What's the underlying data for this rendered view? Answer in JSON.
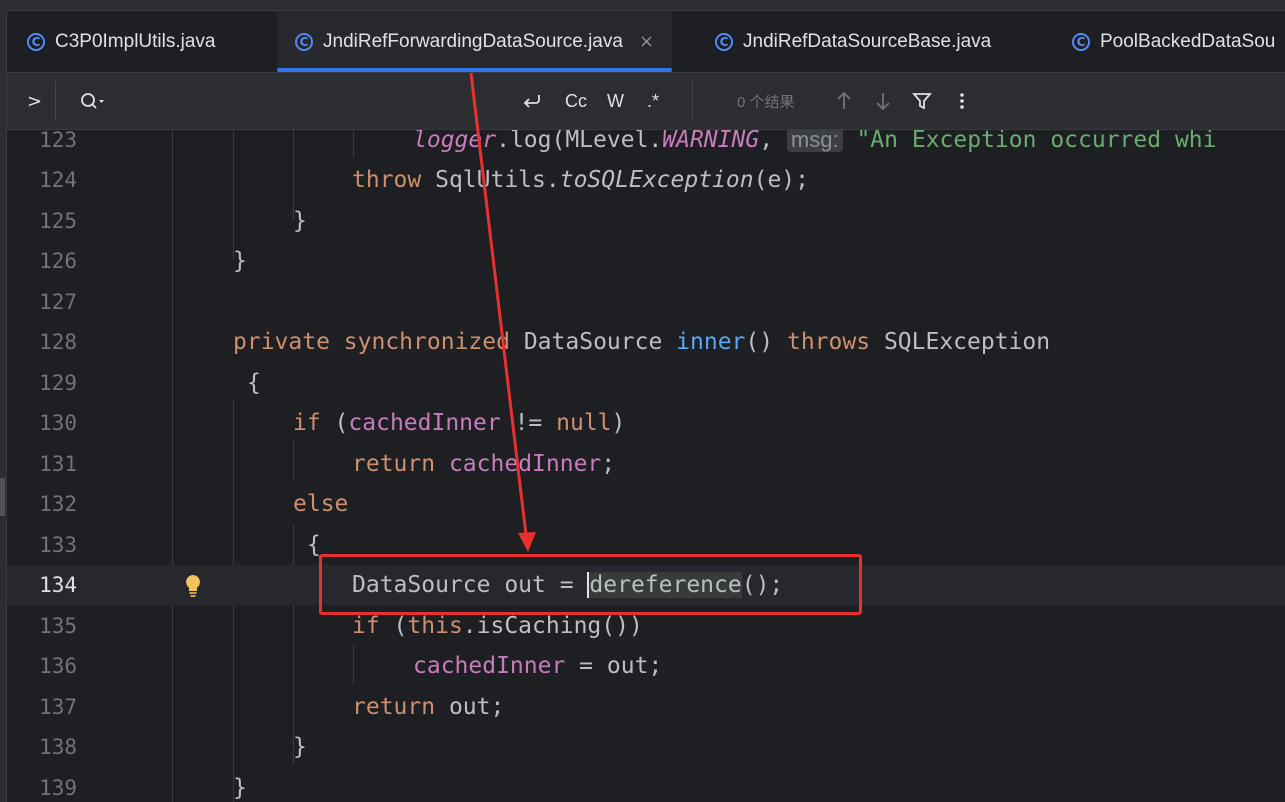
{
  "tabs": [
    {
      "label": "C3P0ImplUtils.java",
      "active": false
    },
    {
      "label": "JndiRefForwardingDataSource.java",
      "active": true
    },
    {
      "label": "JndiRefDataSourceBase.java",
      "active": false
    },
    {
      "label": "PoolBackedDataSou",
      "active": false
    }
  ],
  "tab_close_glyph": "×",
  "tab_icon_letter": "C",
  "search": {
    "expand_glyph": ">",
    "search_glyph": "Q",
    "match_case": "Cc",
    "words": "W",
    "regex": ".*",
    "results": "0 个结果"
  },
  "code_lines": [
    {
      "num": "123"
    },
    {
      "num": "124"
    },
    {
      "num": "125"
    },
    {
      "num": "126"
    },
    {
      "num": "127"
    },
    {
      "num": "128"
    },
    {
      "num": "129"
    },
    {
      "num": "130"
    },
    {
      "num": "131"
    },
    {
      "num": "132"
    },
    {
      "num": "133"
    },
    {
      "num": "134"
    },
    {
      "num": "135"
    },
    {
      "num": "136"
    },
    {
      "num": "137"
    },
    {
      "num": "138"
    },
    {
      "num": "139"
    }
  ],
  "code": {
    "l123": {
      "obj": "logger",
      "call": ".log(MLevel.",
      "const": "WARNING",
      "comma": ", ",
      "hint": "msg:",
      "str": "\"An Exception occurred whi"
    },
    "l124": {
      "kw": "throw",
      "cls": " SqlUtils.",
      "method": "toSQLException",
      "rest": "(e);"
    },
    "l125": {
      "text": "}"
    },
    "l126": {
      "text": "}"
    },
    "l128": {
      "kw1": "private",
      "kw2": "synchronized",
      "type": "DataSource",
      "method": "inner",
      "paren": "()",
      "kw3": "throws",
      "exc": "SQLException"
    },
    "l129": {
      "text": "{"
    },
    "l130": {
      "kw": "if",
      "open": " (",
      "field": "cachedInner",
      "op": " != ",
      "nul": "null",
      "close": ")"
    },
    "l131": {
      "kw": "return",
      "field": "cachedInner",
      "semi": ";"
    },
    "l132": {
      "kw": "else"
    },
    "l133": {
      "text": "{"
    },
    "l134": {
      "decl": "DataSource out = ",
      "call": "dereference",
      "rest": "();"
    },
    "l135": {
      "kw": "if",
      "open": " (",
      "kw2": "this",
      "rest": ".isCaching())"
    },
    "l136": {
      "field": "cachedInner",
      "rest": " = out;"
    },
    "l137": {
      "kw": "return",
      "rest": " out;"
    },
    "l138": {
      "text": "}"
    },
    "l139": {
      "text": "}"
    }
  },
  "colors": {
    "keyword": "#cf8e6d",
    "field": "#c77dbb",
    "function": "#56a8f5",
    "string": "#6aab73",
    "annotation_red": "#e8312f",
    "accent": "#3574f0"
  }
}
